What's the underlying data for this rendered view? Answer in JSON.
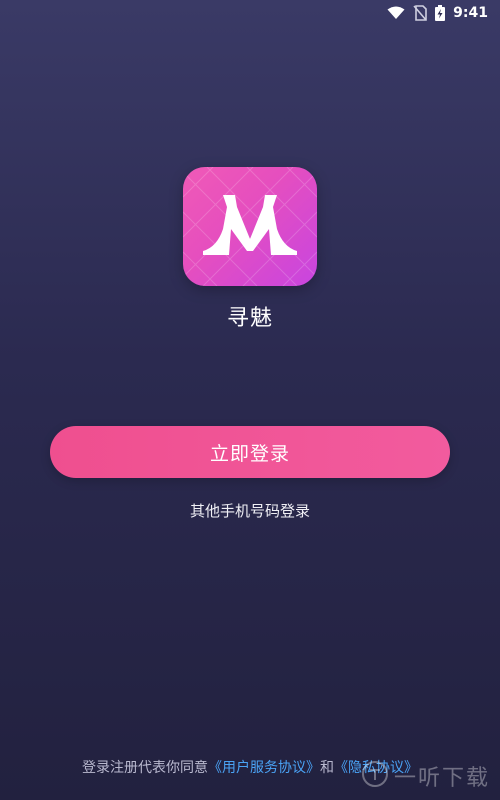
{
  "status_bar": {
    "time": "9:41",
    "icons": [
      "wifi-icon",
      "no-sim-icon",
      "battery-charging-icon"
    ]
  },
  "app": {
    "name": "寻魅",
    "logo_letter": "M",
    "logo_colors": [
      "#f05ab7",
      "#c845e0"
    ]
  },
  "login": {
    "primary_label": "立即登录",
    "other_label": "其他手机号码登录"
  },
  "agreement": {
    "prefix": "登录注册代表你同意",
    "service_link": "《用户服务协议》",
    "conjunction": "和",
    "privacy_link": "《隐私协议》"
  },
  "watermark": {
    "text": "一听下载"
  },
  "colors": {
    "background_top": "#3a3a66",
    "background_bottom": "#22213f",
    "button": "#f0558f",
    "link": "#4aa3f5"
  }
}
